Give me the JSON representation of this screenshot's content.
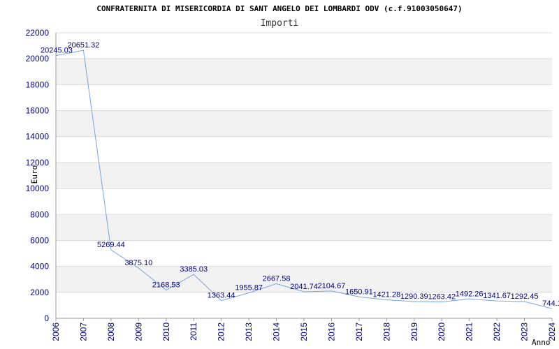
{
  "chart_data": {
    "type": "line",
    "title": "CONFRATERNITA DI MISERICORDIA DI SANT ANGELO DEI LOMBARDI ODV (c.f.91003050647)",
    "subtitle": "Importi",
    "ylabel": "Euro",
    "xlabel": "Anno",
    "ylim": [
      0,
      22000
    ],
    "yticks": [
      "0",
      "2000",
      "4000",
      "6000",
      "8000",
      "10000",
      "12000",
      "14000",
      "16000",
      "18000",
      "20000",
      "22000"
    ],
    "x": [
      "2006",
      "2007",
      "2008",
      "2009",
      "2010",
      "2011",
      "2012",
      "2013",
      "2014",
      "2015",
      "2016",
      "2017",
      "2018",
      "2019",
      "2020",
      "2021",
      "2022",
      "2023",
      "2024"
    ],
    "values": [
      20245.03,
      20651.32,
      5269.44,
      3875.1,
      2168.53,
      3385.03,
      1363.44,
      1955.87,
      2667.58,
      2041.74,
      2104.67,
      1650.91,
      1421.28,
      1290.39,
      1263.42,
      1492.26,
      1341.67,
      1292.45,
      744.1
    ],
    "data_labels": [
      "20245.03",
      "20651.32",
      "5269.44",
      "3875.10",
      "2168.53",
      "3385.03",
      "1363.44",
      "1955.87",
      "2667.58",
      "2041.74",
      "2104.67",
      "1650.91",
      "1421.28",
      "1290.39",
      "1263.42",
      "1492.26",
      "1341.67",
      "1292.45",
      "744.1"
    ],
    "grid": true,
    "line_color": "#6aa8e8",
    "band_color": "#f2f2f2",
    "grid_color": "#d9d9d9",
    "tick_color": "#00008b"
  }
}
